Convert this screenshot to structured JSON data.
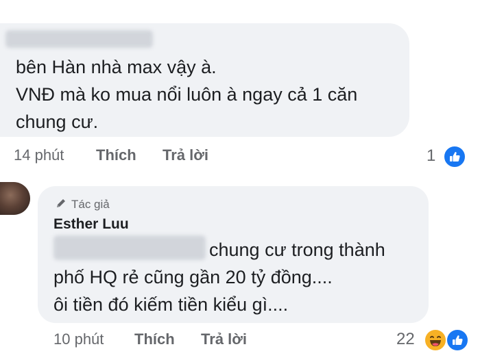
{
  "comment1": {
    "lines": [
      "bên Hàn nhà max vậy à.",
      "VNĐ mà ko mua nổi luôn à ngay cả 1 căn",
      "chung cư."
    ],
    "time": "14 phút",
    "like_label": "Thích",
    "reply_label": "Trả lời",
    "reaction_count": "1",
    "reaction_icons": [
      "like-icon"
    ]
  },
  "comment2": {
    "author_badge": "Tác giả",
    "author_name": "Esther Luu",
    "lines": [
      "chung cư trong thành",
      "phố HQ rẻ cũng gần 20 tỷ đồng....",
      "ôi tiền đó kiếm tiền kiểu gì...."
    ],
    "time": "10 phút",
    "like_label": "Thích",
    "reply_label": "Trả lời",
    "reaction_count": "22",
    "reaction_icons": [
      "haha-icon",
      "like-icon"
    ]
  },
  "colors": {
    "bubble": "#f0f2f5",
    "text": "#1c1e21",
    "meta": "#65676b",
    "like_blue": "#1877f2",
    "haha_yellow": "#f7b125"
  }
}
